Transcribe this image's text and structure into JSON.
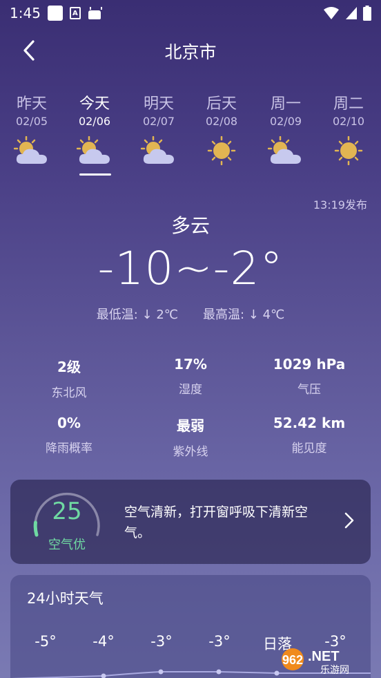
{
  "status": {
    "time": "1:45"
  },
  "header": {
    "city": "北京市"
  },
  "days": [
    {
      "name": "昨天",
      "date": "02/05",
      "icon": "partly-cloudy-icon",
      "active": false
    },
    {
      "name": "今天",
      "date": "02/06",
      "icon": "partly-cloudy-icon",
      "active": true
    },
    {
      "name": "明天",
      "date": "02/07",
      "icon": "partly-cloudy-icon",
      "active": false
    },
    {
      "name": "后天",
      "date": "02/08",
      "icon": "sun-icon",
      "active": false
    },
    {
      "name": "周一",
      "date": "02/09",
      "icon": "partly-cloudy-icon",
      "active": false
    },
    {
      "name": "周二",
      "date": "02/10",
      "icon": "sun-icon",
      "active": false
    }
  ],
  "today": {
    "published": "13:19发布",
    "condition": "多云",
    "range": "-10~-2°",
    "min_label": "最低温: ↓ 2℃",
    "max_label": "最高温: ↓ 4℃"
  },
  "stats": [
    {
      "value": "2级",
      "label": "东北风"
    },
    {
      "value": "17%",
      "label": "湿度"
    },
    {
      "value": "1029 hPa",
      "label": "气压"
    },
    {
      "value": "0%",
      "label": "降雨概率"
    },
    {
      "value": "最弱",
      "label": "紫外线"
    },
    {
      "value": "52.42 km",
      "label": "能见度"
    }
  ],
  "aqi": {
    "value": "25",
    "level": "空气优",
    "advice": "空气清新，打开窗呼吸下清新空气。",
    "color": "#6fd9a2"
  },
  "hourly": {
    "title": "24小时天气",
    "items": [
      "-5°",
      "-4°",
      "-3°",
      "-3°",
      "日落",
      "-3°"
    ]
  },
  "watermark": {
    "text": "962",
    "suffix": ".NET",
    "sub": "乐游网"
  }
}
